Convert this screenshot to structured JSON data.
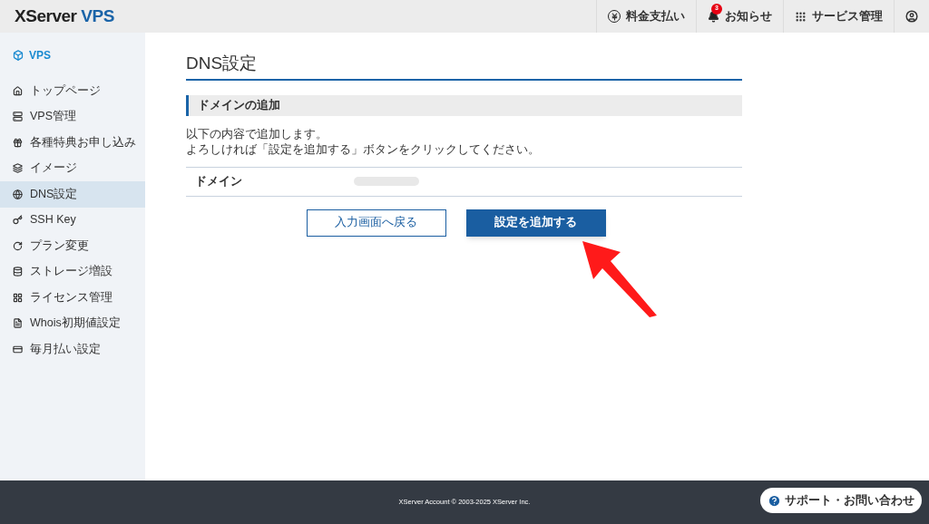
{
  "header": {
    "logo": {
      "part1": "XServer",
      "part2": "VPS"
    },
    "nav": [
      {
        "label": "料金支払い"
      },
      {
        "label": "お知らせ",
        "badge": "3"
      },
      {
        "label": "サービス管理"
      }
    ]
  },
  "sidebar": {
    "title": "VPS",
    "items": [
      {
        "label": "トップページ",
        "selected": false
      },
      {
        "label": "VPS管理",
        "selected": false
      },
      {
        "label": "各種特典お申し込み",
        "selected": false
      },
      {
        "label": "イメージ",
        "selected": false
      },
      {
        "label": "DNS設定",
        "selected": true
      },
      {
        "label": "SSH Key",
        "selected": false
      },
      {
        "label": "プラン変更",
        "selected": false
      },
      {
        "label": "ストレージ増設",
        "selected": false
      },
      {
        "label": "ライセンス管理",
        "selected": false
      },
      {
        "label": "Whois初期値設定",
        "selected": false
      },
      {
        "label": "毎月払い設定",
        "selected": false
      }
    ]
  },
  "page": {
    "title": "DNS設定",
    "section": "ドメインの追加",
    "description": [
      "以下の内容で追加します。",
      "よろしければ「設定を追加する」ボタンをクリックしてください。"
    ],
    "fields": [
      {
        "label": "ドメイン"
      }
    ],
    "buttons": [
      {
        "label": "入力画面へ戻る",
        "kind": "secondary"
      },
      {
        "label": "設定を追加する",
        "kind": "primary"
      }
    ]
  },
  "footer": {
    "copyright": "XServer Account © 2003-2025 XServer Inc.",
    "support": "サポート・お問い合わせ"
  }
}
